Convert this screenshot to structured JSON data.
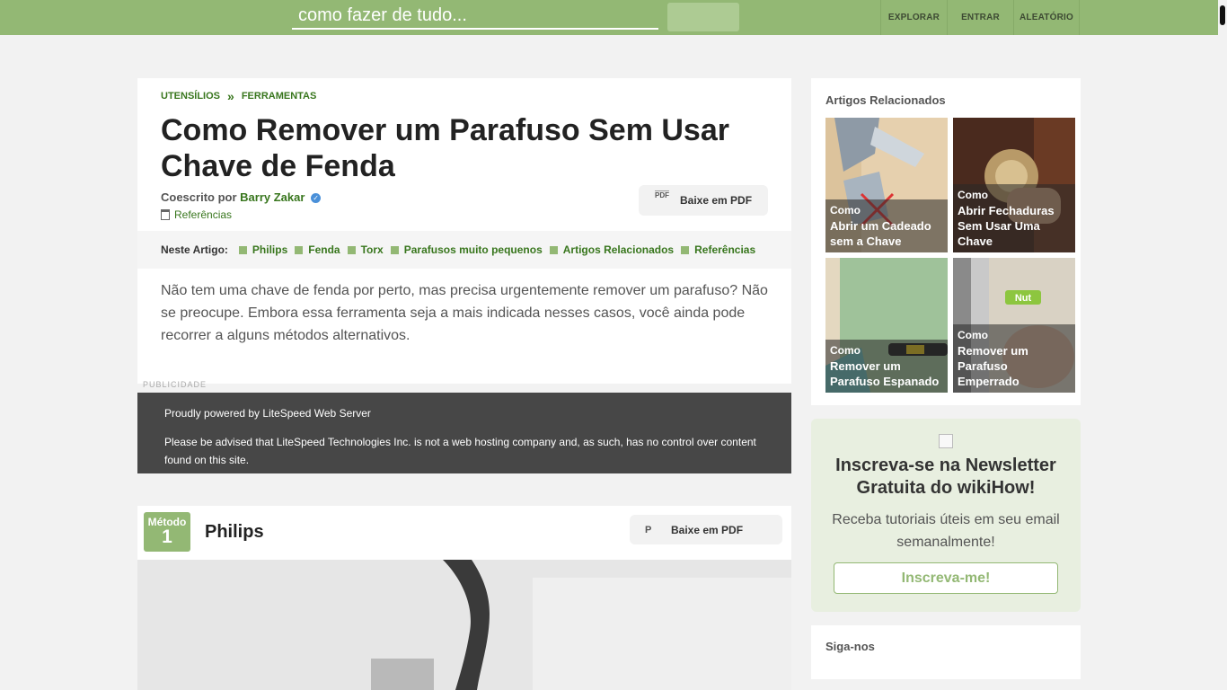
{
  "header": {
    "search_placeholder": "como fazer de tudo...",
    "nav": [
      "EXPLORAR",
      "ENTRAR",
      "ALEATÓRIO"
    ],
    "brand_color": "#93b874"
  },
  "article": {
    "breadcrumb": [
      "UTENSÍLIOS",
      "FERRAMENTAS"
    ],
    "breadcrumb_sep": "»",
    "title": "Como Remover um Parafuso Sem Usar Chave de Fenda",
    "byline_prefix": "Coescrito por",
    "author": "Barry Zakar",
    "references_link": "Referências",
    "pdf_button": "Baixe em PDF",
    "pdf_alt": "PDF",
    "toc_label": "Neste Artigo:",
    "toc": [
      "Philips",
      "Fenda",
      "Torx",
      "Parafusos muito pequenos",
      "Artigos Relacionados",
      "Referências"
    ],
    "intro": "Não tem uma chave de fenda por perto, mas precisa urgentemente remover um parafuso? Não se preocupe. Embora essa ferramenta seja a mais indicada nesses casos, você ainda pode recorrer a alguns métodos alternativos.",
    "ad_label": "PUBLICIDADE"
  },
  "ad_box": {
    "line1": "Proudly powered by LiteSpeed Web Server",
    "line2": "Please be advised that LiteSpeed Technologies Inc. is not a web hosting company and, as such, has no control over content found on this site."
  },
  "method": {
    "label": "Método",
    "number": "1",
    "title": "Philips",
    "pdf_button": "Baixe em PDF",
    "pdf_alt": "P"
  },
  "sidebar": {
    "related_title": "Artigos Relacionados",
    "related": [
      {
        "prefix": "Como",
        "title": "Abrir um Cadeado sem a Chave"
      },
      {
        "prefix": "Como",
        "title": "Abrir Fechaduras Sem Usar Uma Chave"
      },
      {
        "prefix": "Como",
        "title": "Remover um Parafuso Espanado"
      },
      {
        "prefix": "Como",
        "title": "Remover um Parafuso Emperrado"
      }
    ],
    "thumb_label": "Nut",
    "newsletter_title": "Inscreva-se na Newsletter Gratuita do wikiHow!",
    "newsletter_text": "Receba tutoriais úteis em seu email semanalmente!",
    "newsletter_button": "Inscreva-me!",
    "follow_title": "Siga-nos"
  }
}
